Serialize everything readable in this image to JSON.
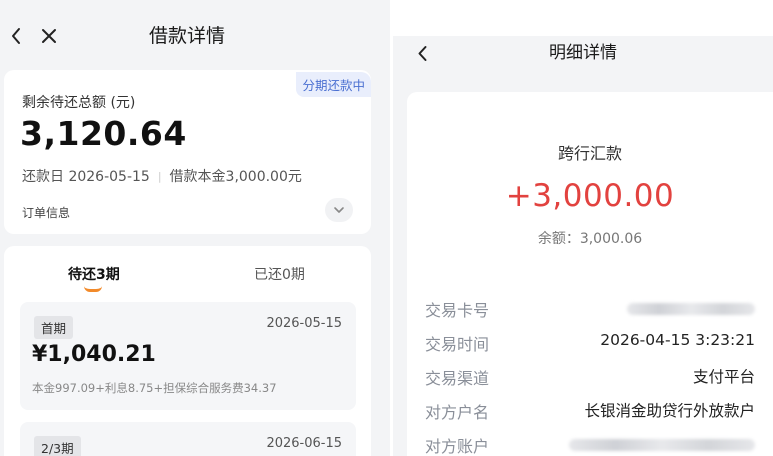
{
  "left": {
    "title": "借款详情",
    "summary": {
      "badge": "分期还款中",
      "remaining_label": "剩余待还总额 (元)",
      "remaining_amount": "3,120.64",
      "due_date_text": "还款日 2026-05-15",
      "principal_text": "借款本金3,000.00元",
      "order_info_label": "订单信息"
    },
    "tabs": [
      {
        "label": "待还3期",
        "active": true
      },
      {
        "label": "已还0期",
        "active": false
      }
    ],
    "periods": [
      {
        "tag": "首期",
        "date": "2026-05-15",
        "amount": "¥1,040.21",
        "breakdown": "本金997.09+利息8.75+担保综合服务费34.37"
      },
      {
        "tag": "2/3期",
        "date": "2026-06-15"
      }
    ]
  },
  "right": {
    "title": "明细详情",
    "transaction_type": "跨行汇款",
    "amount": "+3,000.00",
    "balance": "余额：3,000.06",
    "rows": [
      {
        "label": "交易卡号",
        "value": null
      },
      {
        "label": "交易时间",
        "value": "2026-04-15 3:23:21"
      },
      {
        "label": "交易渠道",
        "value": "支付平台"
      },
      {
        "label": "对方户名",
        "value": "长银消金助贷行外放款户"
      },
      {
        "label": "对方账户",
        "value": null
      }
    ]
  },
  "colors": {
    "accent_orange": "#f28a2a",
    "amount_red": "#e2423f",
    "badge_blue": "#4a6fd1"
  },
  "icons": [
    "back-arrow-icon",
    "close-icon",
    "chevron-down-icon"
  ]
}
